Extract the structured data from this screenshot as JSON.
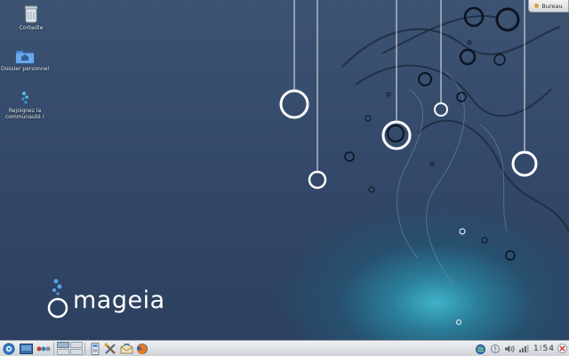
{
  "desktop": {
    "icons": [
      {
        "name": "trash",
        "label": "Corbeille",
        "icon": "trash-icon"
      },
      {
        "name": "home-folder",
        "label": "Dossier personnel",
        "icon": "folder-home-icon"
      },
      {
        "name": "community",
        "label": "Rejoignez la communauté !",
        "icon": "mageia-community-icon"
      }
    ]
  },
  "logo": {
    "text": "mageia",
    "icon": "mageia-logo-icon"
  },
  "activity_button": {
    "label": "Bureau",
    "icon": "activity-lamp-icon"
  },
  "taskbar": {
    "launchers": [
      {
        "name": "application-menu",
        "icon": "kde-launcher-icon"
      },
      {
        "name": "show-desktop",
        "icon": "desktop-icon"
      },
      {
        "name": "activity-manager",
        "icon": "activity-dots-icon"
      }
    ],
    "pager": [
      "desktop-1",
      "desktop-2",
      "desktop-3",
      "desktop-4"
    ],
    "quick_launch": [
      {
        "name": "file-manager",
        "icon": "dolphin-icon"
      },
      {
        "name": "system-settings",
        "icon": "tools-icon"
      },
      {
        "name": "mail-client",
        "icon": "mail-icon"
      },
      {
        "name": "web-browser",
        "icon": "firefox-icon"
      }
    ],
    "tray": {
      "icons": [
        "network-globe-icon",
        "notifications-icon",
        "volume-icon",
        "network-icon"
      ],
      "clock": "1⁝54"
    }
  },
  "colors": {
    "background_top": "#3d5372",
    "background_bottom": "#2c3f5e",
    "glow": "#3fb3c8",
    "taskbar": "#e2e5e9"
  }
}
